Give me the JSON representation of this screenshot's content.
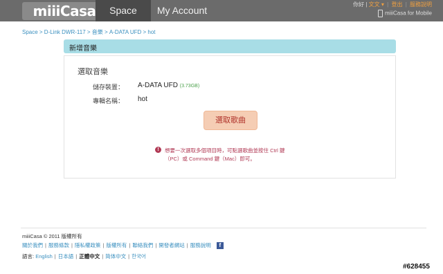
{
  "topbar": {
    "logo": "miiiCasa",
    "tabs": [
      "Space",
      "My Account"
    ],
    "links": [
      "你好 |",
      "文文 ▾",
      "登出",
      "服務說明"
    ],
    "mobile_link": "miiiCasa for Mobile"
  },
  "breadcrumb": "Space > D-Link DWR-117 > 音樂 > A-DATA UFD > hot",
  "panel": {
    "title": "新增音樂",
    "section_title": "選取音樂",
    "storage_label": "儲存裝置：",
    "storage_value": "A-DATA UFD",
    "storage_size": "(3.73GB)",
    "album_label": "專輯名稱：",
    "album_value": "hot",
    "select_button": "選取歌曲",
    "notice_line1": "想要一次選取多個項目時，可點選歌曲並按住 Ctrl 鍵",
    "notice_line2": "（PC）或 Command 鍵（Mac）即可。"
  },
  "footer": {
    "copyright": "miiiCasa © 2011  版權所有",
    "links": [
      "關於我們",
      "服務條款",
      "隱私權政策",
      "版權所有",
      "聯絡我們",
      "開發者網站",
      "服務說明"
    ],
    "language_label": "語言:",
    "languages": [
      "English",
      "日本語",
      "正體中文",
      "简体中文",
      "한국어"
    ],
    "current_language": "正體中文"
  },
  "watermark": "#628455"
}
